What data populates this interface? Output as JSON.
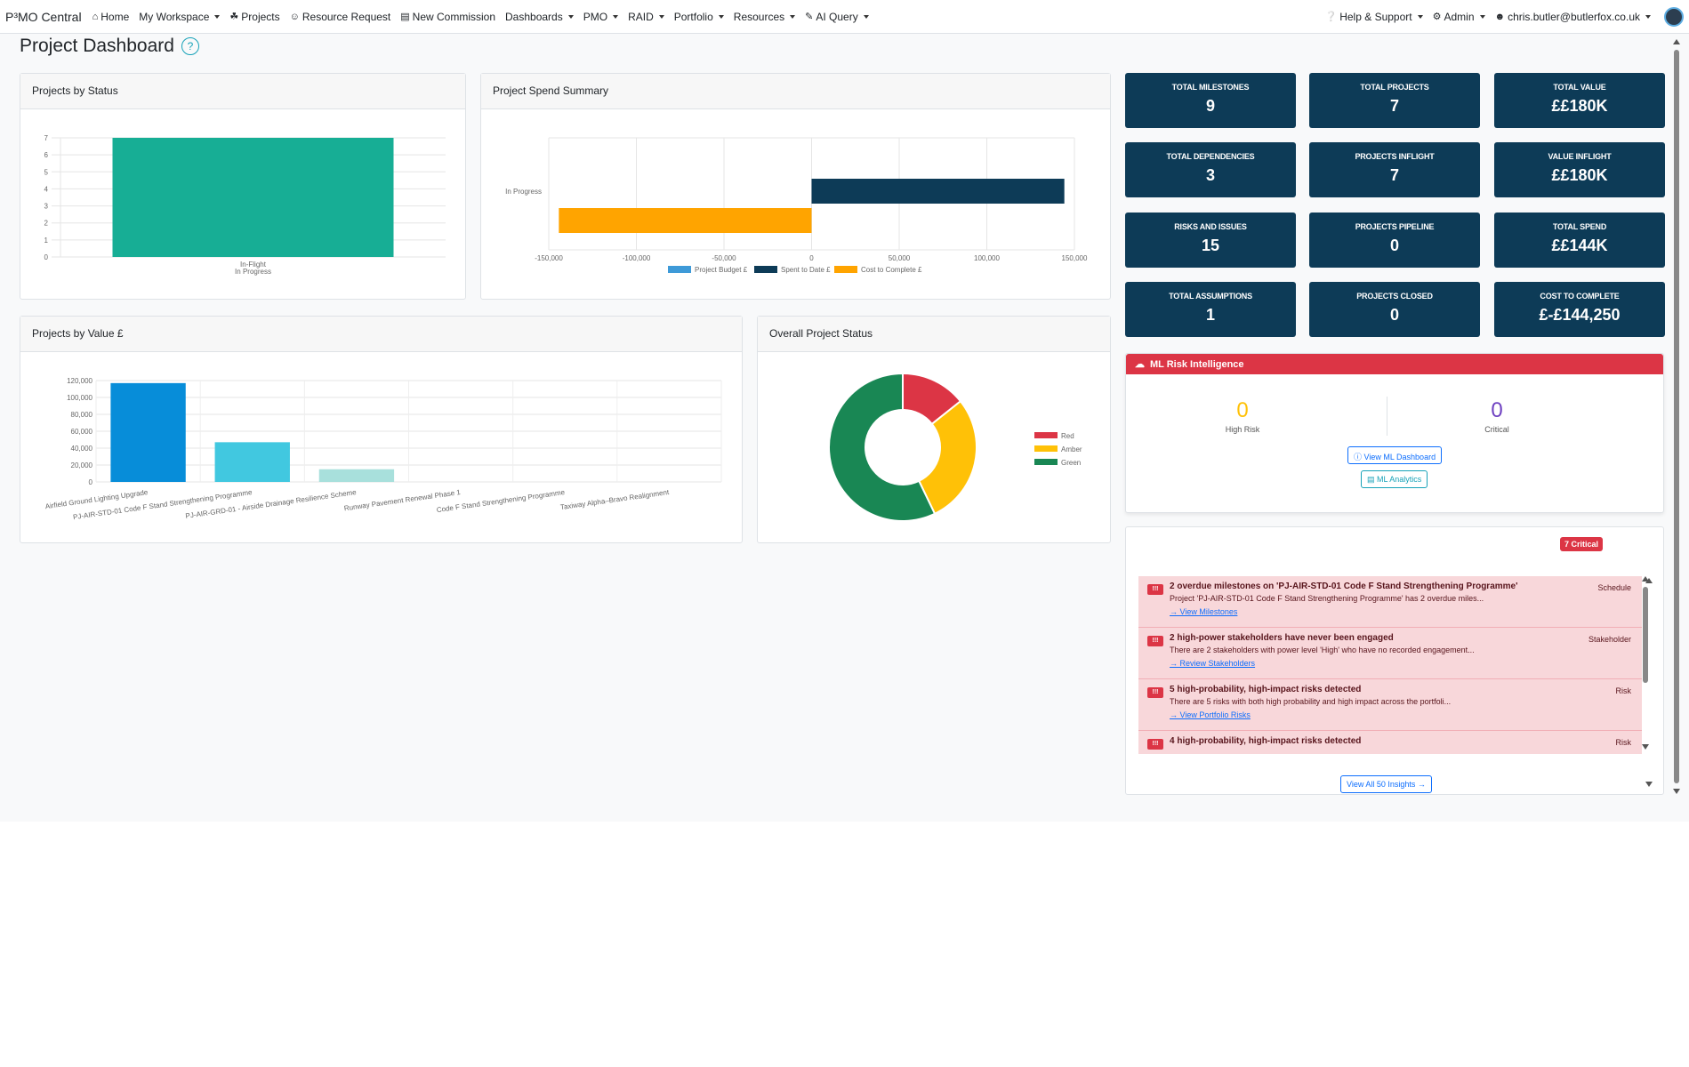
{
  "navbar": {
    "brand": "P³MO Central",
    "items": [
      {
        "label": "Home",
        "icon": "home-icon",
        "glyph": "⌂",
        "dropdown": false
      },
      {
        "label": "My Workspace",
        "icon": "",
        "glyph": "",
        "dropdown": true
      },
      {
        "label": "Projects",
        "icon": "projects-icon",
        "glyph": "☘",
        "dropdown": false
      },
      {
        "label": "Resource Request",
        "icon": "user-plus-icon",
        "glyph": "☺",
        "dropdown": false
      },
      {
        "label": "New Commission",
        "icon": "document-icon",
        "glyph": "▤",
        "dropdown": false
      },
      {
        "label": "Dashboards",
        "icon": "",
        "glyph": "",
        "dropdown": true
      },
      {
        "label": "PMO",
        "icon": "",
        "glyph": "",
        "dropdown": true
      },
      {
        "label": "RAID",
        "icon": "",
        "glyph": "",
        "dropdown": true
      },
      {
        "label": "Portfolio",
        "icon": "",
        "glyph": "",
        "dropdown": true
      },
      {
        "label": "Resources",
        "icon": "",
        "glyph": "",
        "dropdown": true
      },
      {
        "label": "AI Query",
        "icon": "pen-icon",
        "glyph": "✎",
        "dropdown": true
      }
    ],
    "right": {
      "help": "Help & Support",
      "admin": "Admin",
      "user": "chris.butler@butlerfox.co.uk"
    }
  },
  "page": {
    "title": "Project Dashboard",
    "help_glyph": "?"
  },
  "cards": {
    "status_title": "Projects by Status",
    "spend_title": "Project Spend Summary",
    "value_title": "Projects by Value £",
    "overall_title": "Overall Project Status"
  },
  "stats": [
    {
      "label": "Total Milestones",
      "value": "9"
    },
    {
      "label": "Total Projects",
      "value": "7"
    },
    {
      "label": "Total Value",
      "value": "££180K"
    },
    {
      "label": "Total Dependencies",
      "value": "3"
    },
    {
      "label": "Projects Inflight",
      "value": "7"
    },
    {
      "label": "Value Inflight",
      "value": "££180K"
    },
    {
      "label": "Risks and Issues",
      "value": "15"
    },
    {
      "label": "Projects Pipeline",
      "value": "0"
    },
    {
      "label": "Total Spend",
      "value": "££144K"
    },
    {
      "label": "Total Assumptions",
      "value": "1"
    },
    {
      "label": "Projects Closed",
      "value": "0"
    },
    {
      "label": "Cost to Complete",
      "value": "£-£144,250"
    }
  ],
  "ml": {
    "title": "ML Risk Intelligence",
    "high_risk_value": "0",
    "high_risk_label": "High Risk",
    "critical_value": "0",
    "critical_label": "Critical",
    "dashboard_button": "View ML Dashboard",
    "analytics_button": "ML Analytics",
    "high_color": "#ffc107",
    "critical_color": "#6f42c1"
  },
  "insights": {
    "critical_badge": "7 Critical",
    "badge_glyph": "!!!",
    "items": [
      {
        "title": "2 overdue milestones on 'PJ-AIR-STD-01 Code F Stand Strengthening Programme'",
        "desc": "Project 'PJ-AIR-STD-01 Code F Stand Strengthening Programme' has 2 overdue miles...",
        "link": "View Milestones",
        "category": "Schedule"
      },
      {
        "title": "2 high-power stakeholders have never been engaged",
        "desc": "There are 2 stakeholders with power level 'High' who have no recorded engagement...",
        "link": "Review Stakeholders",
        "category": "Stakeholder"
      },
      {
        "title": "5 high-probability, high-impact risks detected",
        "desc": "There are 5 risks with both high probability and high impact across the portfoli...",
        "link": "View Portfolio Risks",
        "category": "Risk"
      },
      {
        "title": "4 high-probability, high-impact risks detected",
        "desc": "",
        "link": "",
        "category": "Risk"
      }
    ],
    "view_all": "View All 50 Insights →"
  },
  "chart_data": [
    {
      "type": "bar",
      "title": "Projects by Status",
      "categories": [
        [
          "In-Flight",
          "In Progress"
        ]
      ],
      "values": [
        7
      ],
      "ylim": [
        0,
        7
      ],
      "yticks": [
        "0",
        "1",
        "2",
        "3",
        "4",
        "5",
        "6",
        "7"
      ],
      "colors": [
        "#17ae95"
      ]
    },
    {
      "type": "bar",
      "orientation": "horizontal",
      "title": "Project Spend Summary",
      "categories": [
        "In Progress"
      ],
      "xlim": [
        -150000,
        150000
      ],
      "xticks": [
        "-150,000",
        "-100,000",
        "-50,000",
        "0",
        "50,000",
        "100,000",
        "150,000"
      ],
      "series": [
        {
          "name": "Project Budget £",
          "values": [
            0
          ],
          "color": "#3e9ad8"
        },
        {
          "name": "Spent to Date £",
          "values": [
            144250
          ],
          "color": "#0d3b57"
        },
        {
          "name": "Cost to Complete £",
          "values": [
            -144250
          ],
          "color": "#ffa400"
        }
      ]
    },
    {
      "type": "bar",
      "title": "Projects by Value £",
      "categories": [
        "Airfield Ground Lighting Upgrade",
        "PJ-AIR-STD-01 Code F Stand Strengthening Programme",
        "PJ-AIR-GRD-01 - Airside Drainage Resilience Scheme",
        "Runway Pavement Renewal Phase 1",
        "Code F Stand Strengthening Programme",
        "Taxiway Alpha–Bravo Realignment"
      ],
      "values": [
        117000,
        47000,
        15000,
        0,
        0,
        0
      ],
      "ylim": [
        0,
        120000
      ],
      "yticks": [
        "0",
        "20,000",
        "40,000",
        "60,000",
        "80,000",
        "100,000",
        "120,000"
      ],
      "colors": [
        "#078dd9",
        "#41c8e0",
        "#a8e0dc",
        "#cccccc",
        "#cccccc",
        "#cccccc"
      ]
    },
    {
      "type": "pie",
      "title": "Overall Project Status",
      "categories": [
        "Red",
        "Amber",
        "Green"
      ],
      "values": [
        1,
        2,
        4
      ],
      "colors": [
        "#dc3545",
        "#ffc107",
        "#198754"
      ]
    }
  ]
}
